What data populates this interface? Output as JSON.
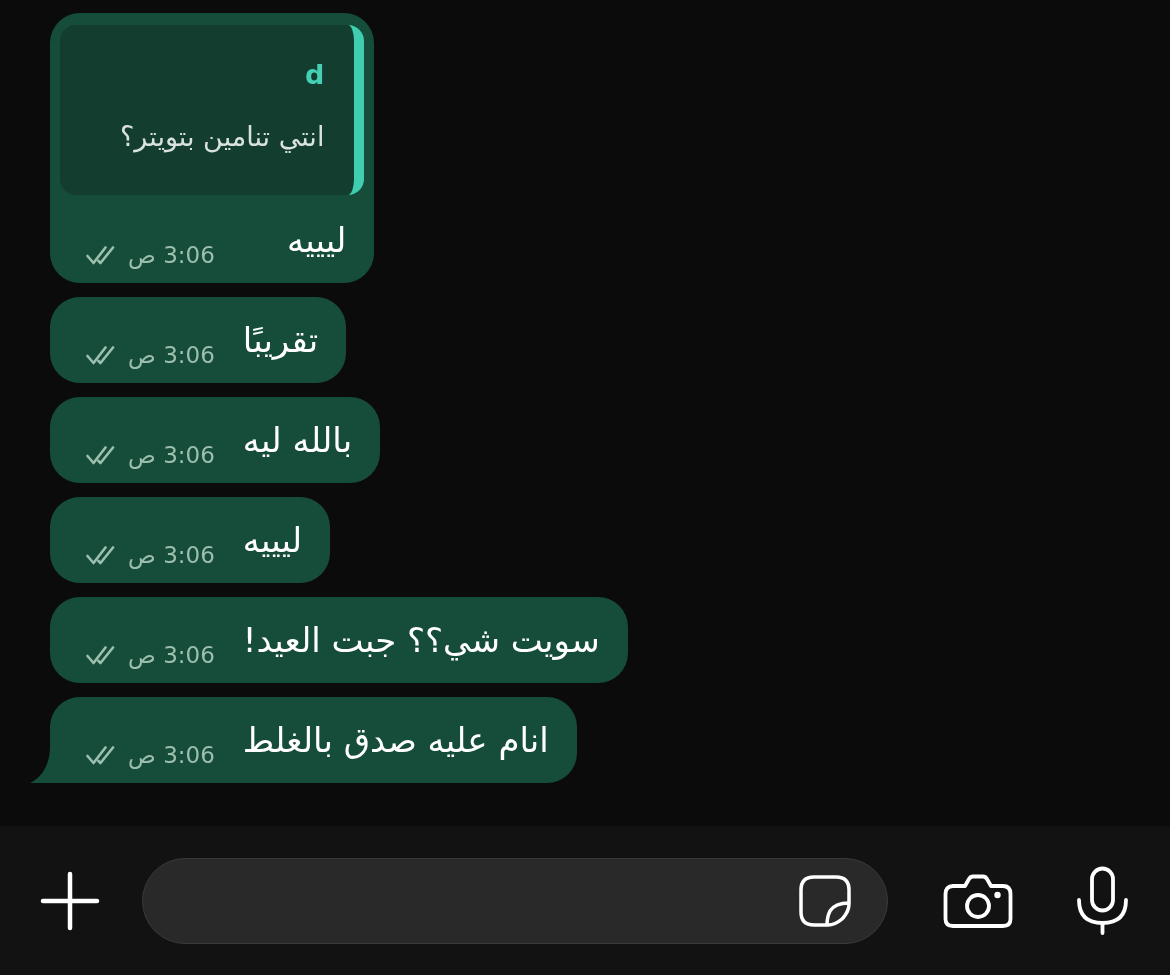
{
  "messages": [
    {
      "quote": {
        "sender": "d",
        "text": "انتي تنامين بتويتر؟"
      },
      "text": "ليييه",
      "time": "3:06 ص",
      "read": false,
      "tail": false
    },
    {
      "text": "تقريبًا",
      "time": "3:06 ص",
      "read": false,
      "tail": false
    },
    {
      "text": "بالله ليه",
      "time": "3:06 ص",
      "read": false,
      "tail": false
    },
    {
      "text": "ليييه",
      "time": "3:06 ص",
      "read": false,
      "tail": false
    },
    {
      "text": "سويت شي؟؟ جبت العيد!",
      "time": "3:06 ص",
      "read": false,
      "tail": false
    },
    {
      "text": "انام عليه صدق بالغلط",
      "time": "3:06 ص",
      "read": false,
      "tail": true
    }
  ]
}
